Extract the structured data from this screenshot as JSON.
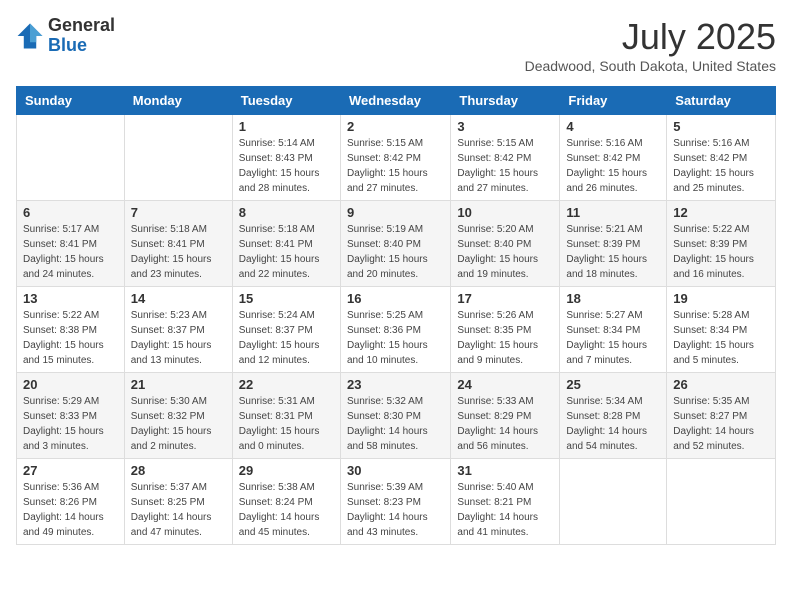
{
  "logo": {
    "general": "General",
    "blue": "Blue"
  },
  "title": "July 2025",
  "location": "Deadwood, South Dakota, United States",
  "weekdays": [
    "Sunday",
    "Monday",
    "Tuesday",
    "Wednesday",
    "Thursday",
    "Friday",
    "Saturday"
  ],
  "weeks": [
    [
      {
        "day": "",
        "sunrise": "",
        "sunset": "",
        "daylight": ""
      },
      {
        "day": "",
        "sunrise": "",
        "sunset": "",
        "daylight": ""
      },
      {
        "day": "1",
        "sunrise": "Sunrise: 5:14 AM",
        "sunset": "Sunset: 8:43 PM",
        "daylight": "Daylight: 15 hours and 28 minutes."
      },
      {
        "day": "2",
        "sunrise": "Sunrise: 5:15 AM",
        "sunset": "Sunset: 8:42 PM",
        "daylight": "Daylight: 15 hours and 27 minutes."
      },
      {
        "day": "3",
        "sunrise": "Sunrise: 5:15 AM",
        "sunset": "Sunset: 8:42 PM",
        "daylight": "Daylight: 15 hours and 27 minutes."
      },
      {
        "day": "4",
        "sunrise": "Sunrise: 5:16 AM",
        "sunset": "Sunset: 8:42 PM",
        "daylight": "Daylight: 15 hours and 26 minutes."
      },
      {
        "day": "5",
        "sunrise": "Sunrise: 5:16 AM",
        "sunset": "Sunset: 8:42 PM",
        "daylight": "Daylight: 15 hours and 25 minutes."
      }
    ],
    [
      {
        "day": "6",
        "sunrise": "Sunrise: 5:17 AM",
        "sunset": "Sunset: 8:41 PM",
        "daylight": "Daylight: 15 hours and 24 minutes."
      },
      {
        "day": "7",
        "sunrise": "Sunrise: 5:18 AM",
        "sunset": "Sunset: 8:41 PM",
        "daylight": "Daylight: 15 hours and 23 minutes."
      },
      {
        "day": "8",
        "sunrise": "Sunrise: 5:18 AM",
        "sunset": "Sunset: 8:41 PM",
        "daylight": "Daylight: 15 hours and 22 minutes."
      },
      {
        "day": "9",
        "sunrise": "Sunrise: 5:19 AM",
        "sunset": "Sunset: 8:40 PM",
        "daylight": "Daylight: 15 hours and 20 minutes."
      },
      {
        "day": "10",
        "sunrise": "Sunrise: 5:20 AM",
        "sunset": "Sunset: 8:40 PM",
        "daylight": "Daylight: 15 hours and 19 minutes."
      },
      {
        "day": "11",
        "sunrise": "Sunrise: 5:21 AM",
        "sunset": "Sunset: 8:39 PM",
        "daylight": "Daylight: 15 hours and 18 minutes."
      },
      {
        "day": "12",
        "sunrise": "Sunrise: 5:22 AM",
        "sunset": "Sunset: 8:39 PM",
        "daylight": "Daylight: 15 hours and 16 minutes."
      }
    ],
    [
      {
        "day": "13",
        "sunrise": "Sunrise: 5:22 AM",
        "sunset": "Sunset: 8:38 PM",
        "daylight": "Daylight: 15 hours and 15 minutes."
      },
      {
        "day": "14",
        "sunrise": "Sunrise: 5:23 AM",
        "sunset": "Sunset: 8:37 PM",
        "daylight": "Daylight: 15 hours and 13 minutes."
      },
      {
        "day": "15",
        "sunrise": "Sunrise: 5:24 AM",
        "sunset": "Sunset: 8:37 PM",
        "daylight": "Daylight: 15 hours and 12 minutes."
      },
      {
        "day": "16",
        "sunrise": "Sunrise: 5:25 AM",
        "sunset": "Sunset: 8:36 PM",
        "daylight": "Daylight: 15 hours and 10 minutes."
      },
      {
        "day": "17",
        "sunrise": "Sunrise: 5:26 AM",
        "sunset": "Sunset: 8:35 PM",
        "daylight": "Daylight: 15 hours and 9 minutes."
      },
      {
        "day": "18",
        "sunrise": "Sunrise: 5:27 AM",
        "sunset": "Sunset: 8:34 PM",
        "daylight": "Daylight: 15 hours and 7 minutes."
      },
      {
        "day": "19",
        "sunrise": "Sunrise: 5:28 AM",
        "sunset": "Sunset: 8:34 PM",
        "daylight": "Daylight: 15 hours and 5 minutes."
      }
    ],
    [
      {
        "day": "20",
        "sunrise": "Sunrise: 5:29 AM",
        "sunset": "Sunset: 8:33 PM",
        "daylight": "Daylight: 15 hours and 3 minutes."
      },
      {
        "day": "21",
        "sunrise": "Sunrise: 5:30 AM",
        "sunset": "Sunset: 8:32 PM",
        "daylight": "Daylight: 15 hours and 2 minutes."
      },
      {
        "day": "22",
        "sunrise": "Sunrise: 5:31 AM",
        "sunset": "Sunset: 8:31 PM",
        "daylight": "Daylight: 15 hours and 0 minutes."
      },
      {
        "day": "23",
        "sunrise": "Sunrise: 5:32 AM",
        "sunset": "Sunset: 8:30 PM",
        "daylight": "Daylight: 14 hours and 58 minutes."
      },
      {
        "day": "24",
        "sunrise": "Sunrise: 5:33 AM",
        "sunset": "Sunset: 8:29 PM",
        "daylight": "Daylight: 14 hours and 56 minutes."
      },
      {
        "day": "25",
        "sunrise": "Sunrise: 5:34 AM",
        "sunset": "Sunset: 8:28 PM",
        "daylight": "Daylight: 14 hours and 54 minutes."
      },
      {
        "day": "26",
        "sunrise": "Sunrise: 5:35 AM",
        "sunset": "Sunset: 8:27 PM",
        "daylight": "Daylight: 14 hours and 52 minutes."
      }
    ],
    [
      {
        "day": "27",
        "sunrise": "Sunrise: 5:36 AM",
        "sunset": "Sunset: 8:26 PM",
        "daylight": "Daylight: 14 hours and 49 minutes."
      },
      {
        "day": "28",
        "sunrise": "Sunrise: 5:37 AM",
        "sunset": "Sunset: 8:25 PM",
        "daylight": "Daylight: 14 hours and 47 minutes."
      },
      {
        "day": "29",
        "sunrise": "Sunrise: 5:38 AM",
        "sunset": "Sunset: 8:24 PM",
        "daylight": "Daylight: 14 hours and 45 minutes."
      },
      {
        "day": "30",
        "sunrise": "Sunrise: 5:39 AM",
        "sunset": "Sunset: 8:23 PM",
        "daylight": "Daylight: 14 hours and 43 minutes."
      },
      {
        "day": "31",
        "sunrise": "Sunrise: 5:40 AM",
        "sunset": "Sunset: 8:21 PM",
        "daylight": "Daylight: 14 hours and 41 minutes."
      },
      {
        "day": "",
        "sunrise": "",
        "sunset": "",
        "daylight": ""
      },
      {
        "day": "",
        "sunrise": "",
        "sunset": "",
        "daylight": ""
      }
    ]
  ]
}
